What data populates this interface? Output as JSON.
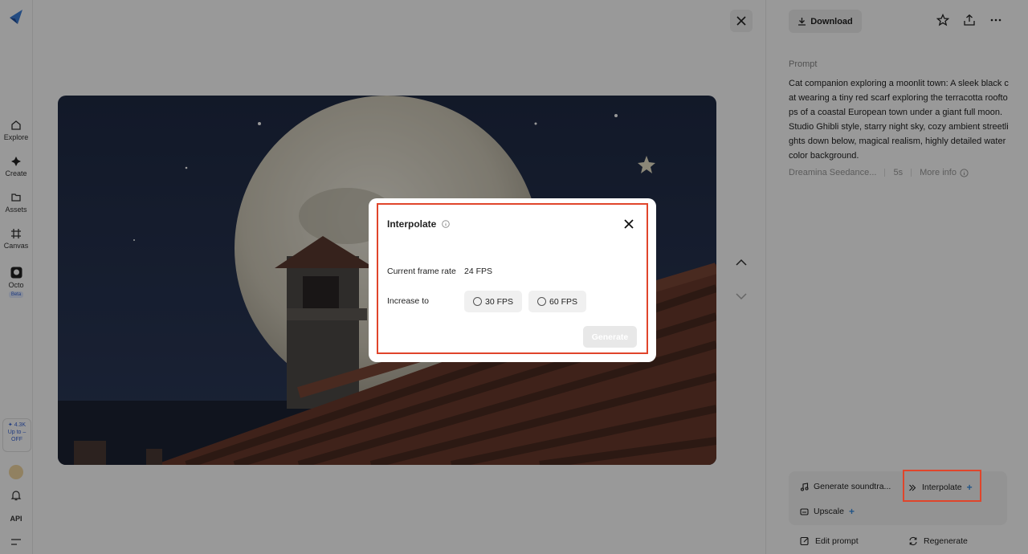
{
  "nav": {
    "items": [
      {
        "label": "Explore",
        "icon": "home-icon"
      },
      {
        "label": "Create",
        "icon": "sparkle-icon"
      },
      {
        "label": "Assets",
        "icon": "folder-icon"
      },
      {
        "label": "Canvas",
        "icon": "canvas-icon"
      },
      {
        "label": "Octo",
        "icon": "octo-icon"
      }
    ],
    "octo_badge": "Beta",
    "credits_count": "✦ 4.3K",
    "credits_promo": "Up to –",
    "credits_off": "OFF",
    "api_label": "API"
  },
  "side": {
    "download_label": "Download",
    "prompt_label": "Prompt",
    "prompt_text": "Cat companion exploring a moonlit town: A sleek black cat wearing a tiny red scarf exploring the terracotta rooftops of a coastal European town under a giant full moon. Studio Ghibli style, starry night sky, cozy ambient streetlights down below, magical realism, highly detailed watercolor background.",
    "model_name": "Dreamina Seedance...",
    "duration": "5s",
    "more_info": "More info",
    "tools": {
      "soundtrack": "Generate soundtra...",
      "interpolate": "Interpolate",
      "upscale": "Upscale",
      "plus": "+"
    },
    "edit_prompt": "Edit prompt",
    "regenerate": "Regenerate"
  },
  "dialog": {
    "title": "Interpolate",
    "current_label": "Current frame rate",
    "current_value": "24 FPS",
    "increase_label": "Increase to",
    "options": [
      "30 FPS",
      "60 FPS"
    ],
    "generate_label": "Generate"
  },
  "colors": {
    "highlight": "#e0452b",
    "accent": "#3a8de0"
  }
}
